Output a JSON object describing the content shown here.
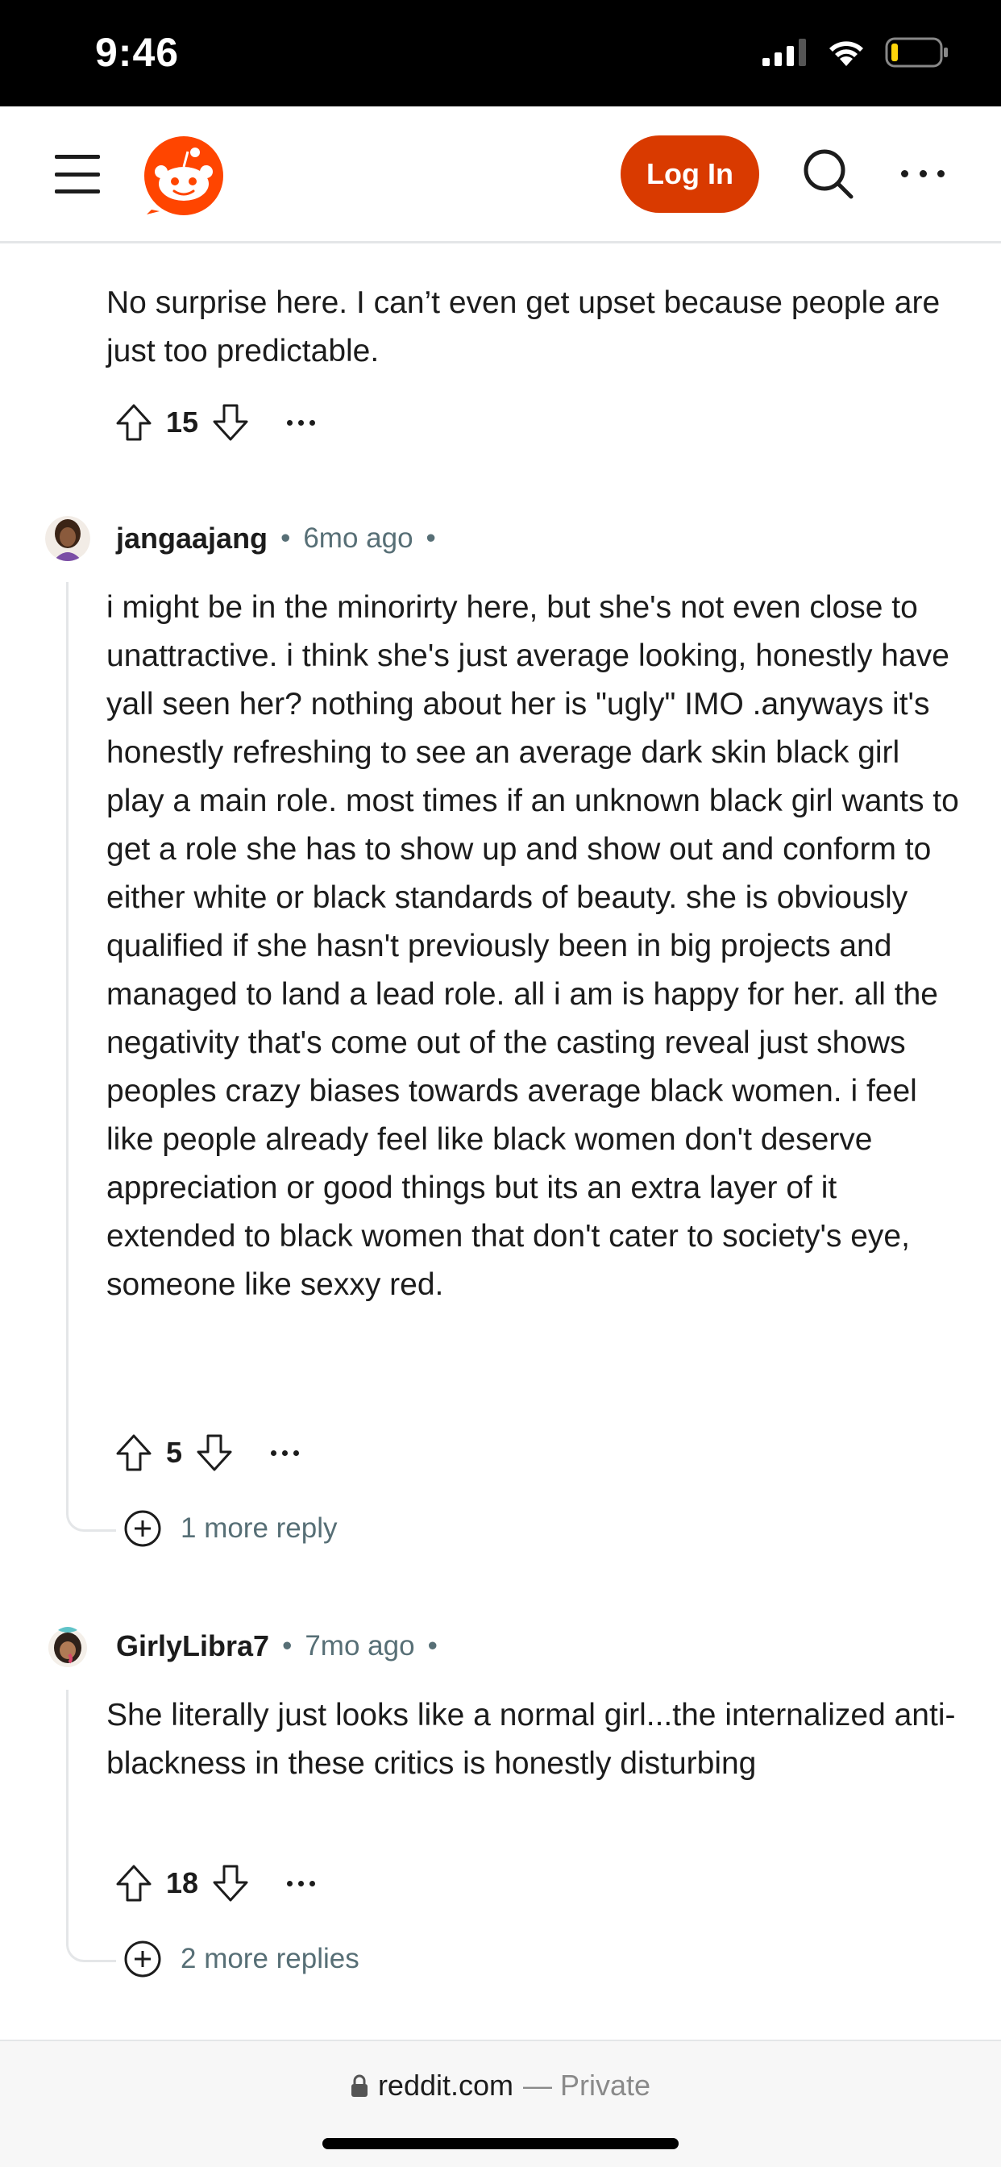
{
  "status": {
    "time": "9:46"
  },
  "header": {
    "login_label": "Log In"
  },
  "comments": [
    {
      "text": "No surprise here. I can’t even get upset because people are just too predictable.",
      "votes": "15"
    },
    {
      "author": "jangaajang",
      "age": "6mo ago",
      "text": "i might be in the minorirty here, but she's not even close to unattractive. i think she's just average looking, honestly have yall seen her? nothing about her is \"ugly\" IMO .anyways it's honestly refreshing to see an average dark skin black girl play a main role. most times if an unknown black girl wants to get a role she has to show up and show out and conform to either white or black standards of beauty. she is obviously qualified if she hasn't previously been in big projects and managed to land a lead role. all i am is happy for her. all the negativity that's come out of the casting reveal just shows peoples crazy biases towards average black women. i feel like people already feel like black women don't deserve appreciation or good things but its an extra layer of it extended to black women that don't cater to society's eye, someone like sexxy red.",
      "votes": "5",
      "more_replies": "1 more reply"
    },
    {
      "author": "GirlyLibra7",
      "age": "7mo ago",
      "text": "She literally just looks like a normal girl...the internalized anti-blackness in these critics is honestly disturbing",
      "votes": "18",
      "more_replies": "2 more replies"
    }
  ],
  "bottom": {
    "domain": "reddit.com",
    "private": "— Private"
  },
  "colors": {
    "brand": "#d93a00",
    "meta": "#576f76",
    "thread": "#e4e6e8"
  },
  "icons": [
    "menu-icon",
    "reddit-logo",
    "search-icon",
    "more-icon",
    "upvote-icon",
    "downvote-icon",
    "plus-circle-icon",
    "lock-icon",
    "signal-icon",
    "wifi-icon",
    "battery-icon"
  ]
}
